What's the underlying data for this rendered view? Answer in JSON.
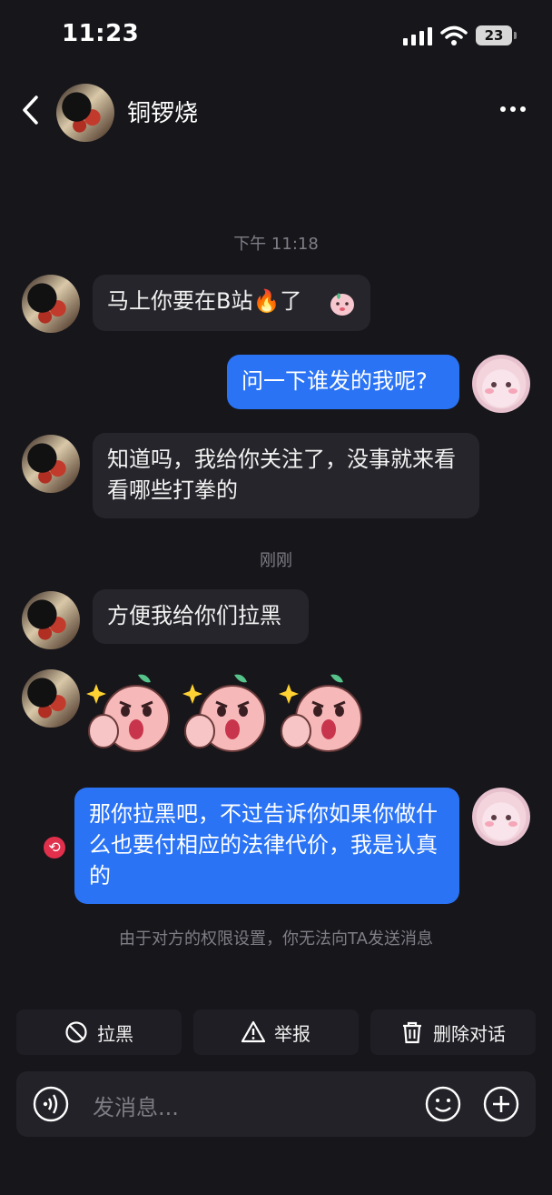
{
  "status_bar": {
    "time": "11:23",
    "battery": "23"
  },
  "header": {
    "contact_name": "铜锣烧"
  },
  "messages": {
    "ts1": "下午 11:18",
    "m1": "马上你要在B站🔥了",
    "m2": "问一下谁发的我呢?",
    "m3": "知道吗，我给你关注了，没事就来看看哪些打拳的",
    "ts2": "刚刚",
    "m4": "方便我给你们拉黑",
    "m5": "那你拉黑吧，不过告诉你如果你做什么也要付相应的法律代价，我是认真的"
  },
  "notice": "由于对方的权限设置，你无法向TA发送消息",
  "actions": {
    "block": "拉黑",
    "report": "举报",
    "delete": "删除对话"
  },
  "input": {
    "placeholder": "发消息..."
  },
  "icons": [
    "back-icon",
    "more-icon",
    "signal-icon",
    "wifi-icon",
    "battery-icon",
    "fire-icon",
    "block-icon",
    "warning-icon",
    "trash-icon",
    "voice-icon",
    "emoji-icon",
    "plus-icon",
    "retry-icon"
  ],
  "colors": {
    "background": "#17161b",
    "outgoing_bubble": "#2a73f5",
    "incoming_bubble": "#26252b",
    "error": "#e0304c"
  }
}
